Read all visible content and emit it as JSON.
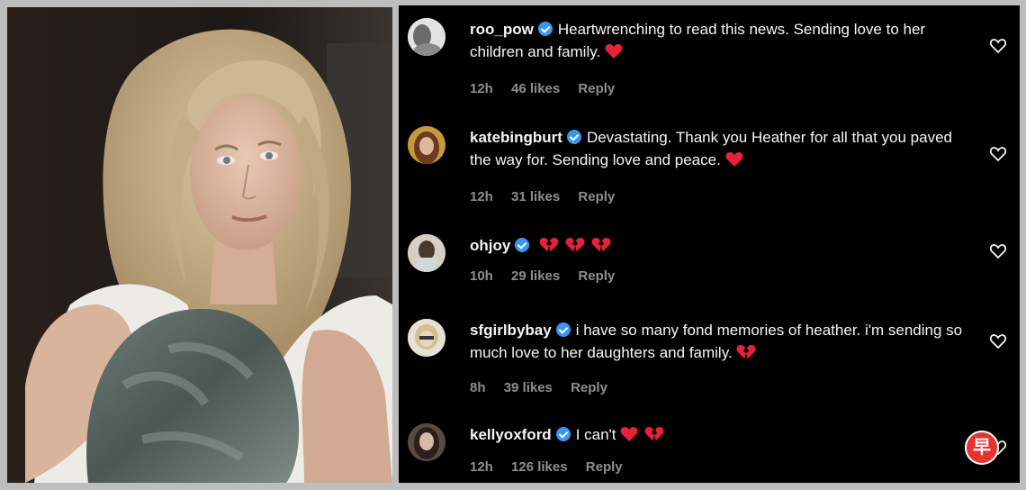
{
  "comments": [
    {
      "username": "roo_pow",
      "text": "Heartwrenching to read this news. Sending love to her children and family.",
      "emojis": [
        "red-heart"
      ],
      "time": "12h",
      "likes": "46 likes",
      "reply": "Reply"
    },
    {
      "username": "katebingburt",
      "text": "Devastating. Thank you Heather for all that you paved the way for. Sending love and peace.",
      "emojis": [
        "red-heart"
      ],
      "time": "12h",
      "likes": "31 likes",
      "reply": "Reply"
    },
    {
      "username": "ohjoy",
      "text": "",
      "emojis": [
        "broken-heart",
        "broken-heart",
        "broken-heart"
      ],
      "time": "10h",
      "likes": "29 likes",
      "reply": "Reply"
    },
    {
      "username": "sfgirlbybay",
      "text": "i have so many fond memories of heather. i'm sending so much love to her daughters and family.",
      "emojis": [
        "broken-heart"
      ],
      "time": "8h",
      "likes": "39 likes",
      "reply": "Reply"
    },
    {
      "username": "kellyoxford",
      "text": "I can't",
      "emojis": [
        "red-heart",
        "broken-heart"
      ],
      "time": "12h",
      "likes": "126 likes",
      "reply": "Reply"
    }
  ],
  "badge": "早",
  "colors": {
    "panel_bg": "#000000",
    "meta": "#8e8e8e",
    "verified": "#3897f0",
    "heart": "#e8203a",
    "badge": "#e8322f"
  }
}
